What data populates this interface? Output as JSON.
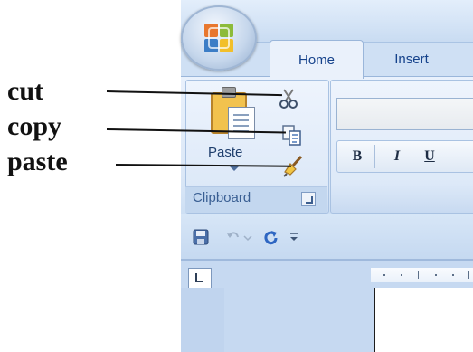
{
  "tabs": [
    {
      "label": "Home",
      "active": true
    },
    {
      "label": "Insert",
      "active": false
    }
  ],
  "clipboard_group": {
    "paste_label": "Paste",
    "group_label": "Clipboard",
    "commands": [
      "cut-icon",
      "copy-icon",
      "format-painter-icon"
    ]
  },
  "font_group": {
    "format_buttons": [
      "B",
      "I",
      "U"
    ]
  },
  "annotations": [
    {
      "label": "cut",
      "target": "cut"
    },
    {
      "label": "copy",
      "target": "copy"
    },
    {
      "label": "paste",
      "target": "format painter"
    }
  ],
  "colors": {
    "ribbon": "#dce8f7",
    "tab_text": "#15428b",
    "annotation_text": "#111111"
  }
}
